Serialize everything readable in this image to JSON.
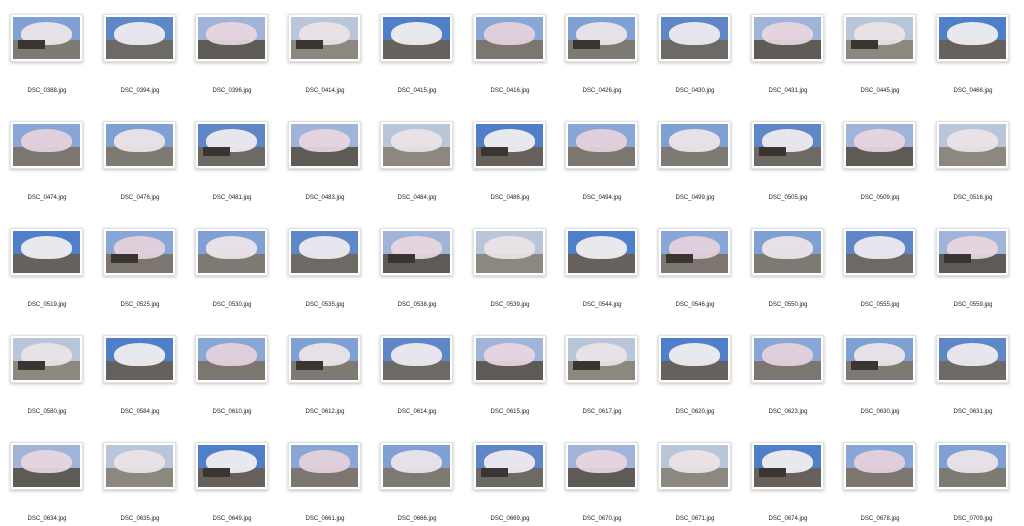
{
  "files": [
    [
      "DSC_0388.jpg",
      "DSC_0394.jpg",
      "DSC_0396.jpg",
      "DSC_0414.jpg",
      "DSC_0415.jpg",
      "DSC_0416.jpg",
      "DSC_0426.jpg",
      "DSC_0430.jpg",
      "DSC_0431.jpg",
      "DSC_0445.jpg",
      "DSC_0466.jpg"
    ],
    [
      "DSC_0474.jpg",
      "DSC_0476.jpg",
      "DSC_0481.jpg",
      "DSC_0483.jpg",
      "DSC_0484.jpg",
      "DSC_0486.jpg",
      "DSC_0494.jpg",
      "DSC_0499.jpg",
      "DSC_0505.jpg",
      "DSC_0509.jpg",
      "DSC_0516.jpg"
    ],
    [
      "DSC_0519.jpg",
      "DSC_0525.jpg",
      "DSC_0530.jpg",
      "DSC_0535.jpg",
      "DSC_0538.jpg",
      "DSC_0539.jpg",
      "DSC_0544.jpg",
      "DSC_0546.jpg",
      "DSC_0550.jpg",
      "DSC_0555.jpg",
      "DSC_0559.jpg"
    ],
    [
      "DSC_0580.jpg",
      "DSC_0584.jpg",
      "DSC_0610.jpg",
      "DSC_0612.jpg",
      "DSC_0614.jpg",
      "DSC_0615.jpg",
      "DSC_0617.jpg",
      "DSC_0620.jpg",
      "DSC_0623.jpg",
      "DSC_0630.jpg",
      "DSC_0631.jpg"
    ],
    [
      "DSC_0634.jpg",
      "DSC_0635.jpg",
      "DSC_0649.jpg",
      "DSC_0661.jpg",
      "DSC_0666.jpg",
      "DSC_0669.jpg",
      "DSC_0670.jpg",
      "DSC_0671.jpg",
      "DSC_0674.jpg",
      "DSC_0678.jpg",
      "DSC_0709.jpg"
    ]
  ],
  "colors": {
    "sky": "#6f93c9",
    "bloom": "#eadfe3",
    "ground": "#8d8a82",
    "background": "#ffffff"
  }
}
